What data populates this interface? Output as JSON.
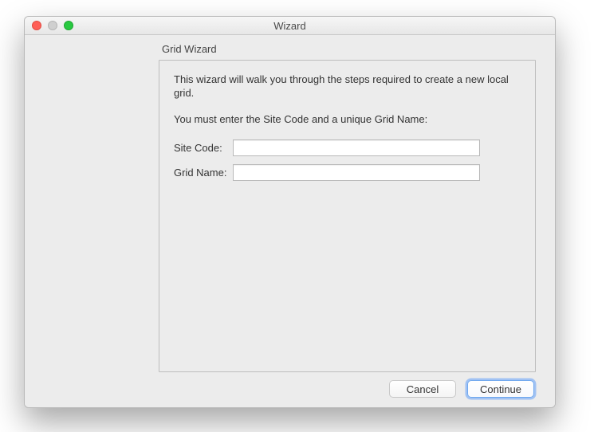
{
  "window": {
    "title": "Wizard"
  },
  "wizard": {
    "heading": "Grid Wizard",
    "intro": "This wizard will walk you through the steps required to create a new local grid.",
    "instruction": "You must enter the Site Code and a unique Grid Name:",
    "fields": {
      "site_code": {
        "label": "Site Code:",
        "value": ""
      },
      "grid_name": {
        "label": "Grid Name:",
        "value": ""
      }
    }
  },
  "buttons": {
    "cancel": "Cancel",
    "continue": "Continue"
  }
}
